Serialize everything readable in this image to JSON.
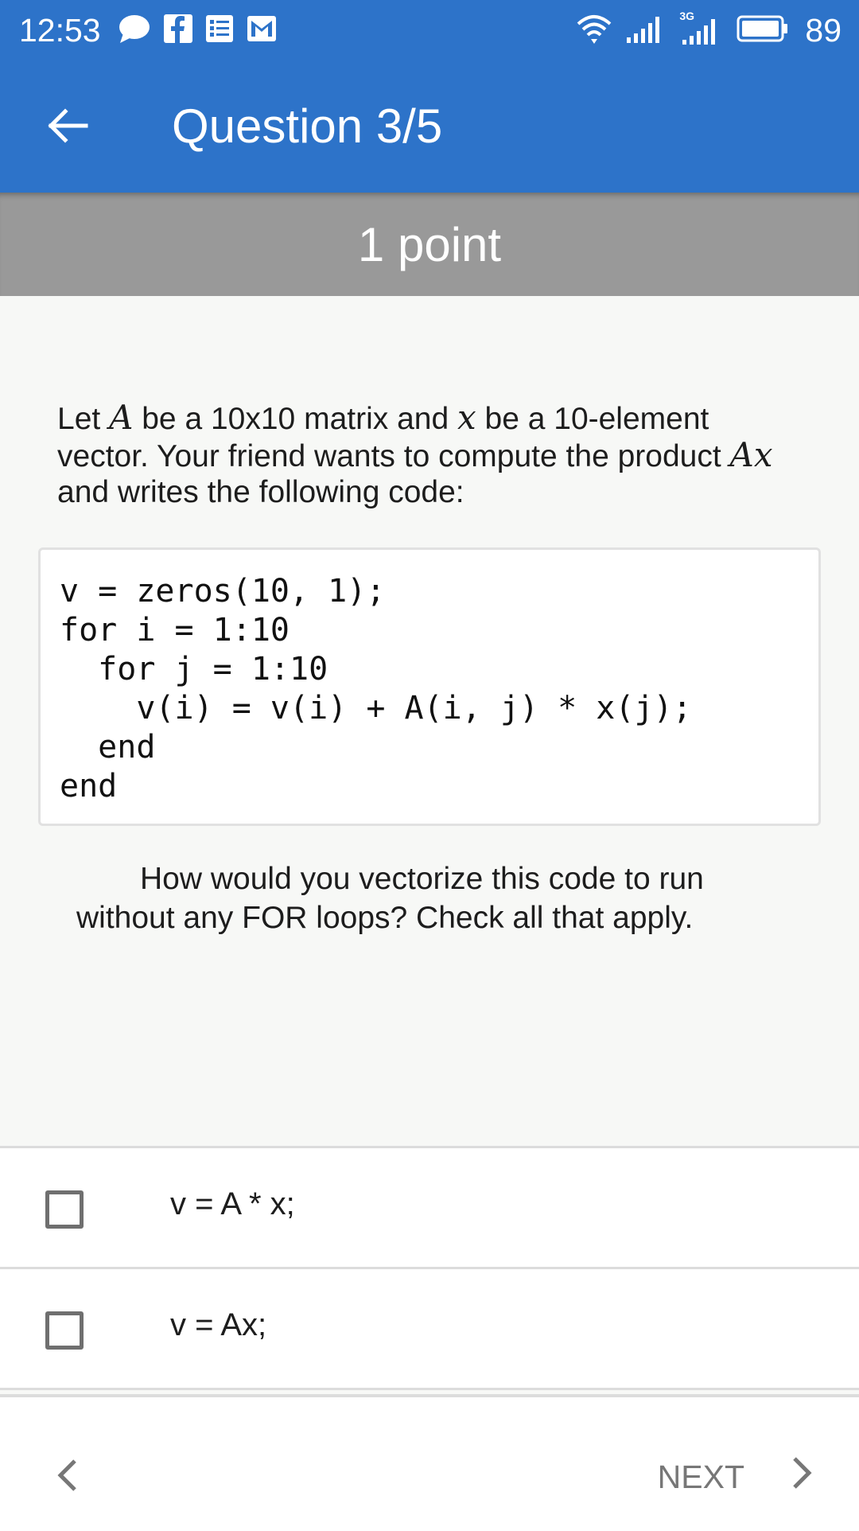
{
  "status_bar": {
    "time": "12:53",
    "left_icons": [
      "chat-bubble-icon",
      "facebook-icon",
      "news-icon",
      "gmail-icon"
    ],
    "right_icons": [
      "wifi-icon",
      "signal-icon",
      "signal-3g-icon",
      "battery-icon"
    ],
    "network_label": "3G",
    "battery_level": "89"
  },
  "app_bar": {
    "title": "Question 3/5",
    "back_icon": "arrow-left-icon"
  },
  "points_banner": {
    "label": "1 point"
  },
  "question": {
    "seg1": "Let ",
    "var_a": "A",
    "seg2": " be a 10x10 matrix and ",
    "var_x": "x",
    "seg3": " be a 10-element vector. Your friend wants to compute the product ",
    "var_ax": "Ax",
    "seg4": " and writes the following code:"
  },
  "code": {
    "lines": [
      "v = zeros(10, 1);",
      "for i = 1:10",
      "  for j = 1:10",
      "    v(i) = v(i) + A(i, j) * x(j);",
      "  end",
      "end"
    ]
  },
  "prompt": {
    "text": "How would you vectorize this code to run without any FOR loops? Check all that apply."
  },
  "options": [
    {
      "label": "v = A * x;",
      "checked": false
    },
    {
      "label": "v = Ax;",
      "checked": false
    }
  ],
  "nav": {
    "next_label": "NEXT",
    "prev_icon": "chevron-left-icon",
    "next_icon": "chevron-right-icon"
  },
  "colors": {
    "primary": "#2d73c9",
    "banner": "#999999",
    "background": "#f7f8f6",
    "checkbox_border": "#6f6f6f",
    "nav_text": "#777777"
  }
}
